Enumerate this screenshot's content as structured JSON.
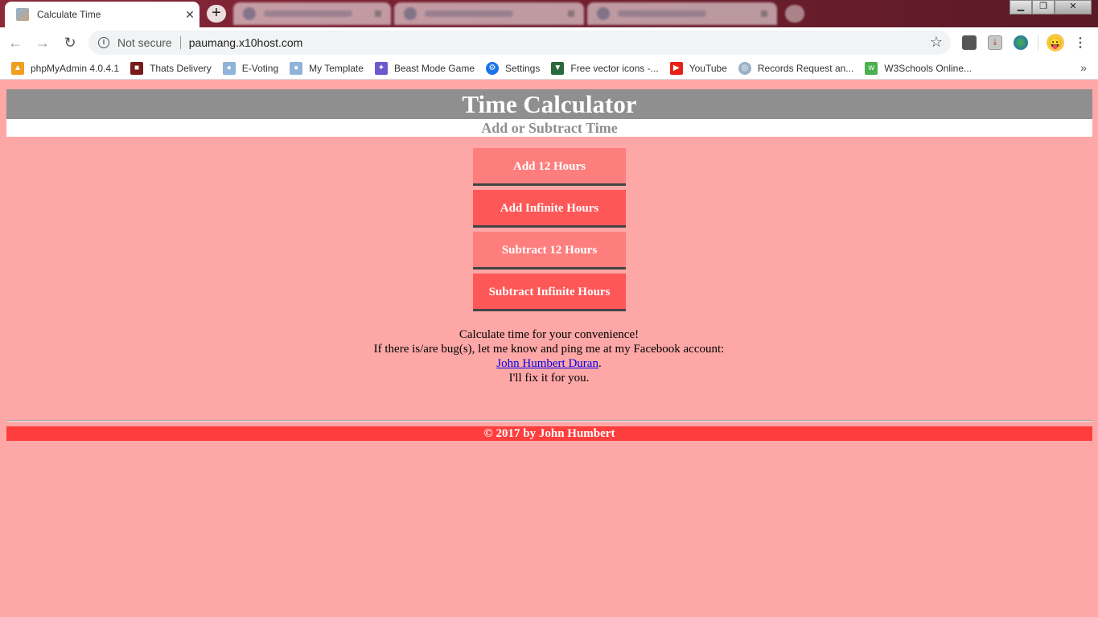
{
  "browser": {
    "active_tab_title": "Calculate Time",
    "not_secure_label": "Not secure",
    "url": "paumang.x10host.com",
    "bookmarks": [
      {
        "label": "phpMyAdmin 4.0.4.1",
        "icon": "pma-icon",
        "color": "#f0a020"
      },
      {
        "label": "Thats Delivery",
        "icon": "delivery-icon",
        "color": "#7a1a1a"
      },
      {
        "label": "E-Voting",
        "icon": "user-icon",
        "color": "#8fb3d9"
      },
      {
        "label": "My Template",
        "icon": "user-icon",
        "color": "#8fb3d9"
      },
      {
        "label": "Beast Mode Game",
        "icon": "game-icon",
        "color": "#6a5acd"
      },
      {
        "label": "Settings",
        "icon": "gear-icon",
        "color": "#1a73e8"
      },
      {
        "label": "Free vector icons -...",
        "icon": "vector-icon",
        "color": "#2a6a3a"
      },
      {
        "label": "YouTube",
        "icon": "youtube-icon",
        "color": "#e62117"
      },
      {
        "label": "Records Request an...",
        "icon": "seal-icon",
        "color": "#9ab0c8"
      },
      {
        "label": "W3Schools Online...",
        "icon": "w3schools-icon",
        "color": "#4caf50"
      }
    ]
  },
  "page": {
    "title": "Time Calculator",
    "subtitle": "Add or Subtract Time",
    "buttons": {
      "add_12": "Add 12 Hours",
      "add_infinite": "Add Infinite Hours",
      "subtract_12": "Subtract 12 Hours",
      "subtract_infinite": "Subtract Infinite Hours"
    },
    "message": {
      "line1": "Calculate time for your convenience!",
      "line2": "If there is/are bug(s), let me know and ping me at my Facebook account:",
      "link": "John Humbert Duran",
      "link_suffix": ".",
      "line4": "I'll fix it for you."
    },
    "footer": "© 2017 by John Humbert"
  },
  "colors": {
    "background": "#fea7a7",
    "header": "#8f8f8f",
    "button_light": "#fe7e7e",
    "button_dark": "#fe5757",
    "footer": "#fe3d3d"
  }
}
